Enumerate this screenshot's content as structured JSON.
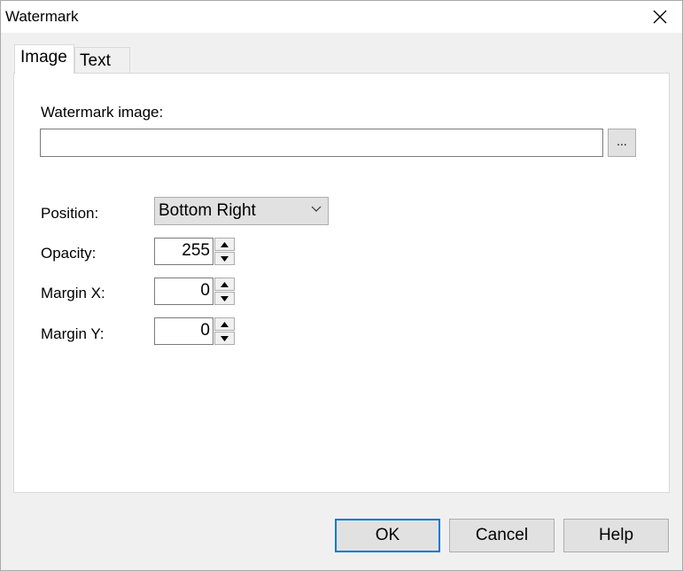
{
  "window": {
    "title": "Watermark"
  },
  "tabs": [
    {
      "label": "Image",
      "active": true
    },
    {
      "label": "Text",
      "active": false
    }
  ],
  "image_tab": {
    "watermark_image_label": "Watermark image:",
    "watermark_image_value": "",
    "browse_label": "...",
    "position_label": "Position:",
    "position_value": "Bottom Right",
    "opacity_label": "Opacity:",
    "opacity_value": "255",
    "margin_x_label": "Margin X:",
    "margin_x_value": "0",
    "margin_y_label": "Margin Y:",
    "margin_y_value": "0"
  },
  "buttons": {
    "ok": "OK",
    "cancel": "Cancel",
    "help": "Help"
  },
  "colors": {
    "focus_border": "#0078d7",
    "button_bg": "#e1e1e1",
    "window_bg": "#f0f0f0"
  },
  "icons": {
    "close": "close-icon",
    "dropdown": "chevron-down-icon",
    "spin_up": "triangle-up-icon",
    "spin_down": "triangle-down-icon"
  }
}
